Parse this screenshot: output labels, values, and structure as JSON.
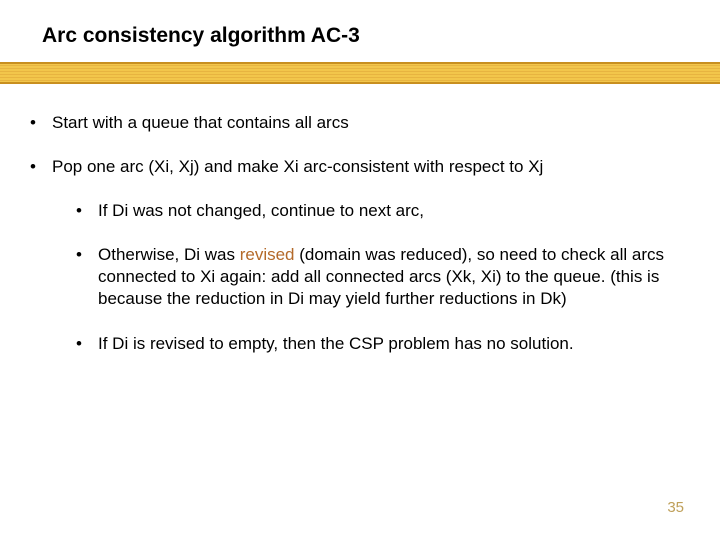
{
  "title": "Arc consistency algorithm AC-3",
  "bullets": {
    "b1a": "Start with a queue that contains all arcs",
    "b1b": "Pop one arc (Xi, Xj) and make Xi arc-consistent with respect to Xj",
    "b2a": "If Di was not changed, continue to next arc,",
    "b2b_pre": "Otherwise, Di was ",
    "b2b_word": "revised",
    "b2b_post": " (domain was reduced), so need to check all arcs connected to Xi again: add all connected arcs (Xk, Xi) to the queue. (this is because the reduction in Di may yield further reductions in Dk)",
    "b2c": "If Di is revised to empty, then the CSP problem has no solution."
  },
  "page_number": "35",
  "bullet_glyph": "•"
}
